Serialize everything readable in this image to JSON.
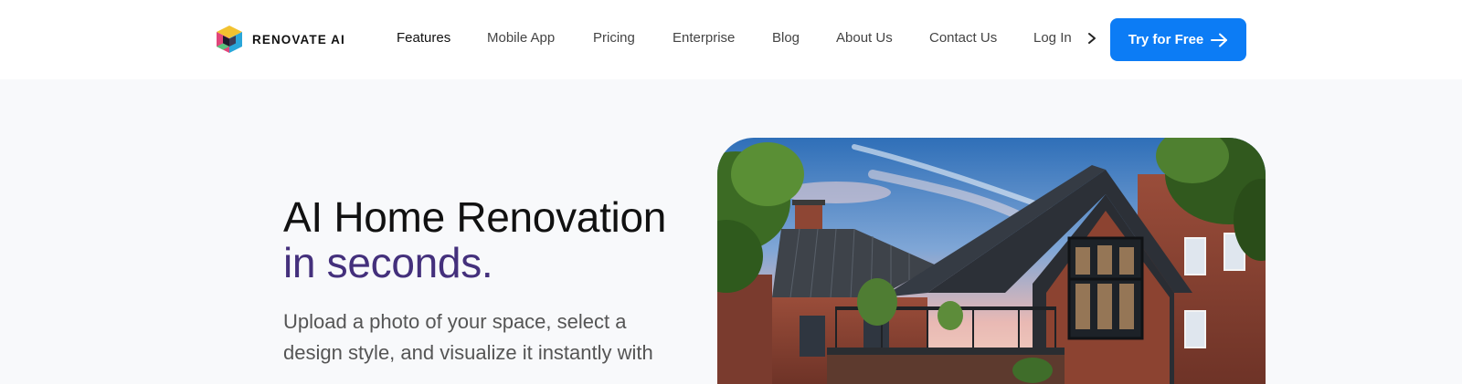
{
  "brand": {
    "name": "RENOVATE AI",
    "logo_icon": "isometric-cube-icon"
  },
  "nav": {
    "items": [
      {
        "label": "Features",
        "active": true
      },
      {
        "label": "Mobile App",
        "active": false
      },
      {
        "label": "Pricing",
        "active": false
      },
      {
        "label": "Enterprise",
        "active": false
      },
      {
        "label": "Blog",
        "active": false
      },
      {
        "label": "About Us",
        "active": false
      },
      {
        "label": "Contact Us",
        "active": false
      }
    ],
    "login_label": "Log In",
    "login_icon": "chevron-right-icon",
    "cta_label": "Try for Free",
    "cta_icon": "arrow-right-icon"
  },
  "hero": {
    "title_line1": "AI Home Renovation",
    "title_line2": "in seconds.",
    "subtitle": "Upload a photo of your space, select a design style, and visualize it instantly with",
    "image_label": "house-exterior-photo"
  },
  "colors": {
    "accent": "#0c7cf5",
    "title_highlight": "#44307c",
    "page_background": "#f8f9fb",
    "nav_background": "#ffffff"
  }
}
